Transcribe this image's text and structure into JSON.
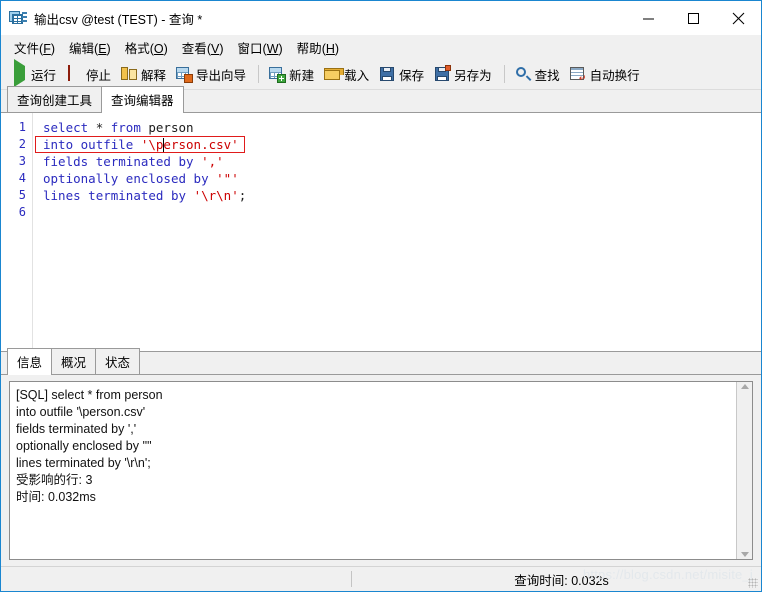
{
  "window": {
    "title": "输出csv @test (TEST) - 查询 *",
    "icon": "table-app-icon",
    "controls": {
      "minimize": "minimize-icon",
      "maximize": "maximize-icon",
      "close": "close-icon"
    }
  },
  "menubar": {
    "items": [
      {
        "label": "文件",
        "accel": "F"
      },
      {
        "label": "编辑",
        "accel": "E"
      },
      {
        "label": "格式",
        "accel": "O"
      },
      {
        "label": "查看",
        "accel": "V"
      },
      {
        "label": "窗口",
        "accel": "W"
      },
      {
        "label": "帮助",
        "accel": "H"
      }
    ]
  },
  "toolbar": {
    "groups": [
      [
        {
          "label": "运行",
          "icon": "run-icon"
        },
        {
          "label": "停止",
          "icon": "stop-icon"
        },
        {
          "label": "解释",
          "icon": "explain-icon"
        },
        {
          "label": "导出向导",
          "icon": "export-wizard-icon"
        }
      ],
      [
        {
          "label": "新建",
          "icon": "new-icon"
        },
        {
          "label": "载入",
          "icon": "load-icon"
        },
        {
          "label": "保存",
          "icon": "save-icon"
        },
        {
          "label": "另存为",
          "icon": "save-as-icon"
        }
      ],
      [
        {
          "label": "查找",
          "icon": "find-icon"
        },
        {
          "label": "自动换行",
          "icon": "word-wrap-icon"
        }
      ]
    ]
  },
  "editor_tabs": [
    {
      "label": "查询创建工具",
      "active": false
    },
    {
      "label": "查询编辑器",
      "active": true
    }
  ],
  "editor": {
    "line_numbers": [
      "1",
      "2",
      "3",
      "4",
      "5",
      "6"
    ],
    "lines": [
      [
        {
          "text": "select",
          "type": "kw"
        },
        {
          "text": " ",
          "type": "plain"
        },
        {
          "text": "*",
          "type": "plain"
        },
        {
          "text": " ",
          "type": "plain"
        },
        {
          "text": "from",
          "type": "kw"
        },
        {
          "text": " person",
          "type": "plain"
        }
      ],
      [
        {
          "text": "into",
          "type": "kw"
        },
        {
          "text": " ",
          "type": "plain"
        },
        {
          "text": "outfile",
          "type": "kw"
        },
        {
          "text": " ",
          "type": "plain"
        },
        {
          "text": "'\\person.csv'",
          "type": "str"
        }
      ],
      [
        {
          "text": "fields",
          "type": "kw"
        },
        {
          "text": " ",
          "type": "plain"
        },
        {
          "text": "terminated",
          "type": "kw"
        },
        {
          "text": " ",
          "type": "plain"
        },
        {
          "text": "by",
          "type": "kw"
        },
        {
          "text": " ",
          "type": "plain"
        },
        {
          "text": "','",
          "type": "str"
        }
      ],
      [
        {
          "text": "optionally",
          "type": "kw"
        },
        {
          "text": " ",
          "type": "plain"
        },
        {
          "text": "enclosed",
          "type": "kw"
        },
        {
          "text": " ",
          "type": "plain"
        },
        {
          "text": "by",
          "type": "kw"
        },
        {
          "text": " ",
          "type": "plain"
        },
        {
          "text": "'\"'",
          "type": "str"
        }
      ],
      [
        {
          "text": "lines",
          "type": "kw"
        },
        {
          "text": " ",
          "type": "plain"
        },
        {
          "text": "terminated",
          "type": "kw"
        },
        {
          "text": " ",
          "type": "plain"
        },
        {
          "text": "by",
          "type": "kw"
        },
        {
          "text": " ",
          "type": "plain"
        },
        {
          "text": "'\\r\\n'",
          "type": "str"
        },
        {
          "text": ";",
          "type": "plain"
        }
      ],
      []
    ],
    "annotation": {
      "color": "#e01b1b",
      "target_line": 2
    }
  },
  "bottom_tabs": [
    {
      "label": "信息",
      "active": true
    },
    {
      "label": "概况",
      "active": false
    },
    {
      "label": "状态",
      "active": false
    }
  ],
  "log": {
    "lines": [
      "[SQL] select * from person",
      "into outfile '\\person.csv'",
      "fields terminated by ','",
      "optionally enclosed by '\"'",
      "lines terminated by '\\r\\n';",
      "受影响的行: 3",
      "时间: 0.032ms"
    ]
  },
  "statusbar": {
    "query_time": "查询时间: 0.032s",
    "watermark": "https://blog.csdn.net/misite_j"
  }
}
